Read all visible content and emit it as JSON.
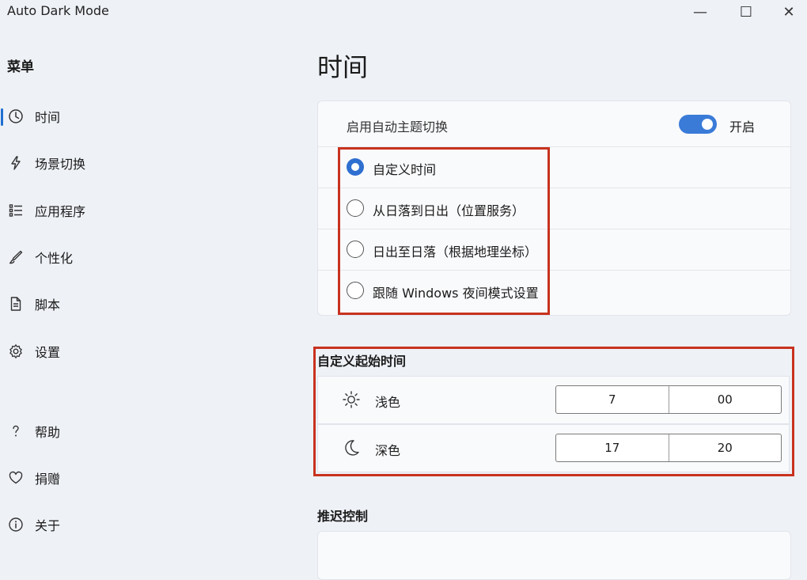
{
  "window": {
    "title": "Auto Dark Mode",
    "minimize_glyph": "—",
    "maximize_glyph": "☐",
    "close_glyph": "✕"
  },
  "sidebar": {
    "menu_title": "菜单",
    "items": [
      {
        "label": "时间",
        "icon": "clock-icon",
        "selected": true
      },
      {
        "label": "场景切换",
        "icon": "lightning-icon",
        "selected": false
      },
      {
        "label": "应用程序",
        "icon": "list-icon",
        "selected": false
      },
      {
        "label": "个性化",
        "icon": "brush-icon",
        "selected": false
      },
      {
        "label": "脚本",
        "icon": "document-icon",
        "selected": false
      },
      {
        "label": "设置",
        "icon": "gear-icon",
        "selected": false
      }
    ],
    "footer_items": [
      {
        "label": "帮助",
        "icon": "question-icon"
      },
      {
        "label": "捐赠",
        "icon": "heart-icon"
      },
      {
        "label": "关于",
        "icon": "info-icon"
      }
    ]
  },
  "main": {
    "page_title": "时间",
    "auto_theme": {
      "label": "启用自动主题切换",
      "toggle_on": true,
      "toggle_label": "开启"
    },
    "modes": [
      {
        "label": "自定义时间",
        "checked": true
      },
      {
        "label": "从日落到日出（位置服务）",
        "checked": false
      },
      {
        "label": "日出至日落（根据地理坐标）",
        "checked": false
      },
      {
        "label": "跟随 Windows 夜间模式设置",
        "checked": false
      }
    ],
    "custom_start": {
      "title": "自定义起始时间",
      "light": {
        "label": "浅色",
        "icon": "sun-icon",
        "hour": "7",
        "minute": "00"
      },
      "dark": {
        "label": "深色",
        "icon": "moon-icon",
        "hour": "17",
        "minute": "20"
      }
    },
    "delay_section_title": "推迟控制"
  },
  "colors": {
    "accent": "#2e6fd0",
    "highlight_box": "#c8321f"
  }
}
